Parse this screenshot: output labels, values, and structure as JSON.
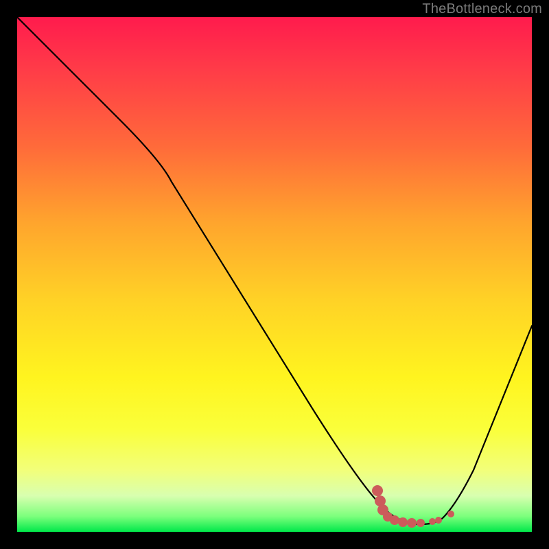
{
  "watermark": "TheBottleneck.com",
  "colors": {
    "curve": "#000000",
    "marker": "#cc5b5b"
  },
  "chart_data": {
    "type": "line",
    "title": "",
    "xlabel": "",
    "ylabel": "",
    "xlim": [
      0,
      100
    ],
    "ylim": [
      0,
      100
    ],
    "series": [
      {
        "name": "bottleneck-curve",
        "x": [
          0,
          20,
          28,
          40,
          55,
          65,
          70,
          74,
          78,
          82,
          84,
          88,
          100
        ],
        "y": [
          100,
          80,
          72,
          58,
          40,
          25,
          15,
          6,
          1,
          0.5,
          2,
          10,
          40
        ]
      }
    ],
    "markers": {
      "name": "highlight-band",
      "points": [
        {
          "x": 70.0,
          "y": 6.5
        },
        {
          "x": 70.5,
          "y": 4.0
        },
        {
          "x": 71.0,
          "y": 2.2
        },
        {
          "x": 72.0,
          "y": 1.8
        },
        {
          "x": 73.5,
          "y": 1.6
        },
        {
          "x": 75.0,
          "y": 1.5
        },
        {
          "x": 76.5,
          "y": 1.4
        },
        {
          "x": 78.0,
          "y": 1.3
        },
        {
          "x": 80.0,
          "y": 1.2
        },
        {
          "x": 82.0,
          "y": 1.1
        },
        {
          "x": 84.0,
          "y": 1.6
        }
      ]
    }
  }
}
